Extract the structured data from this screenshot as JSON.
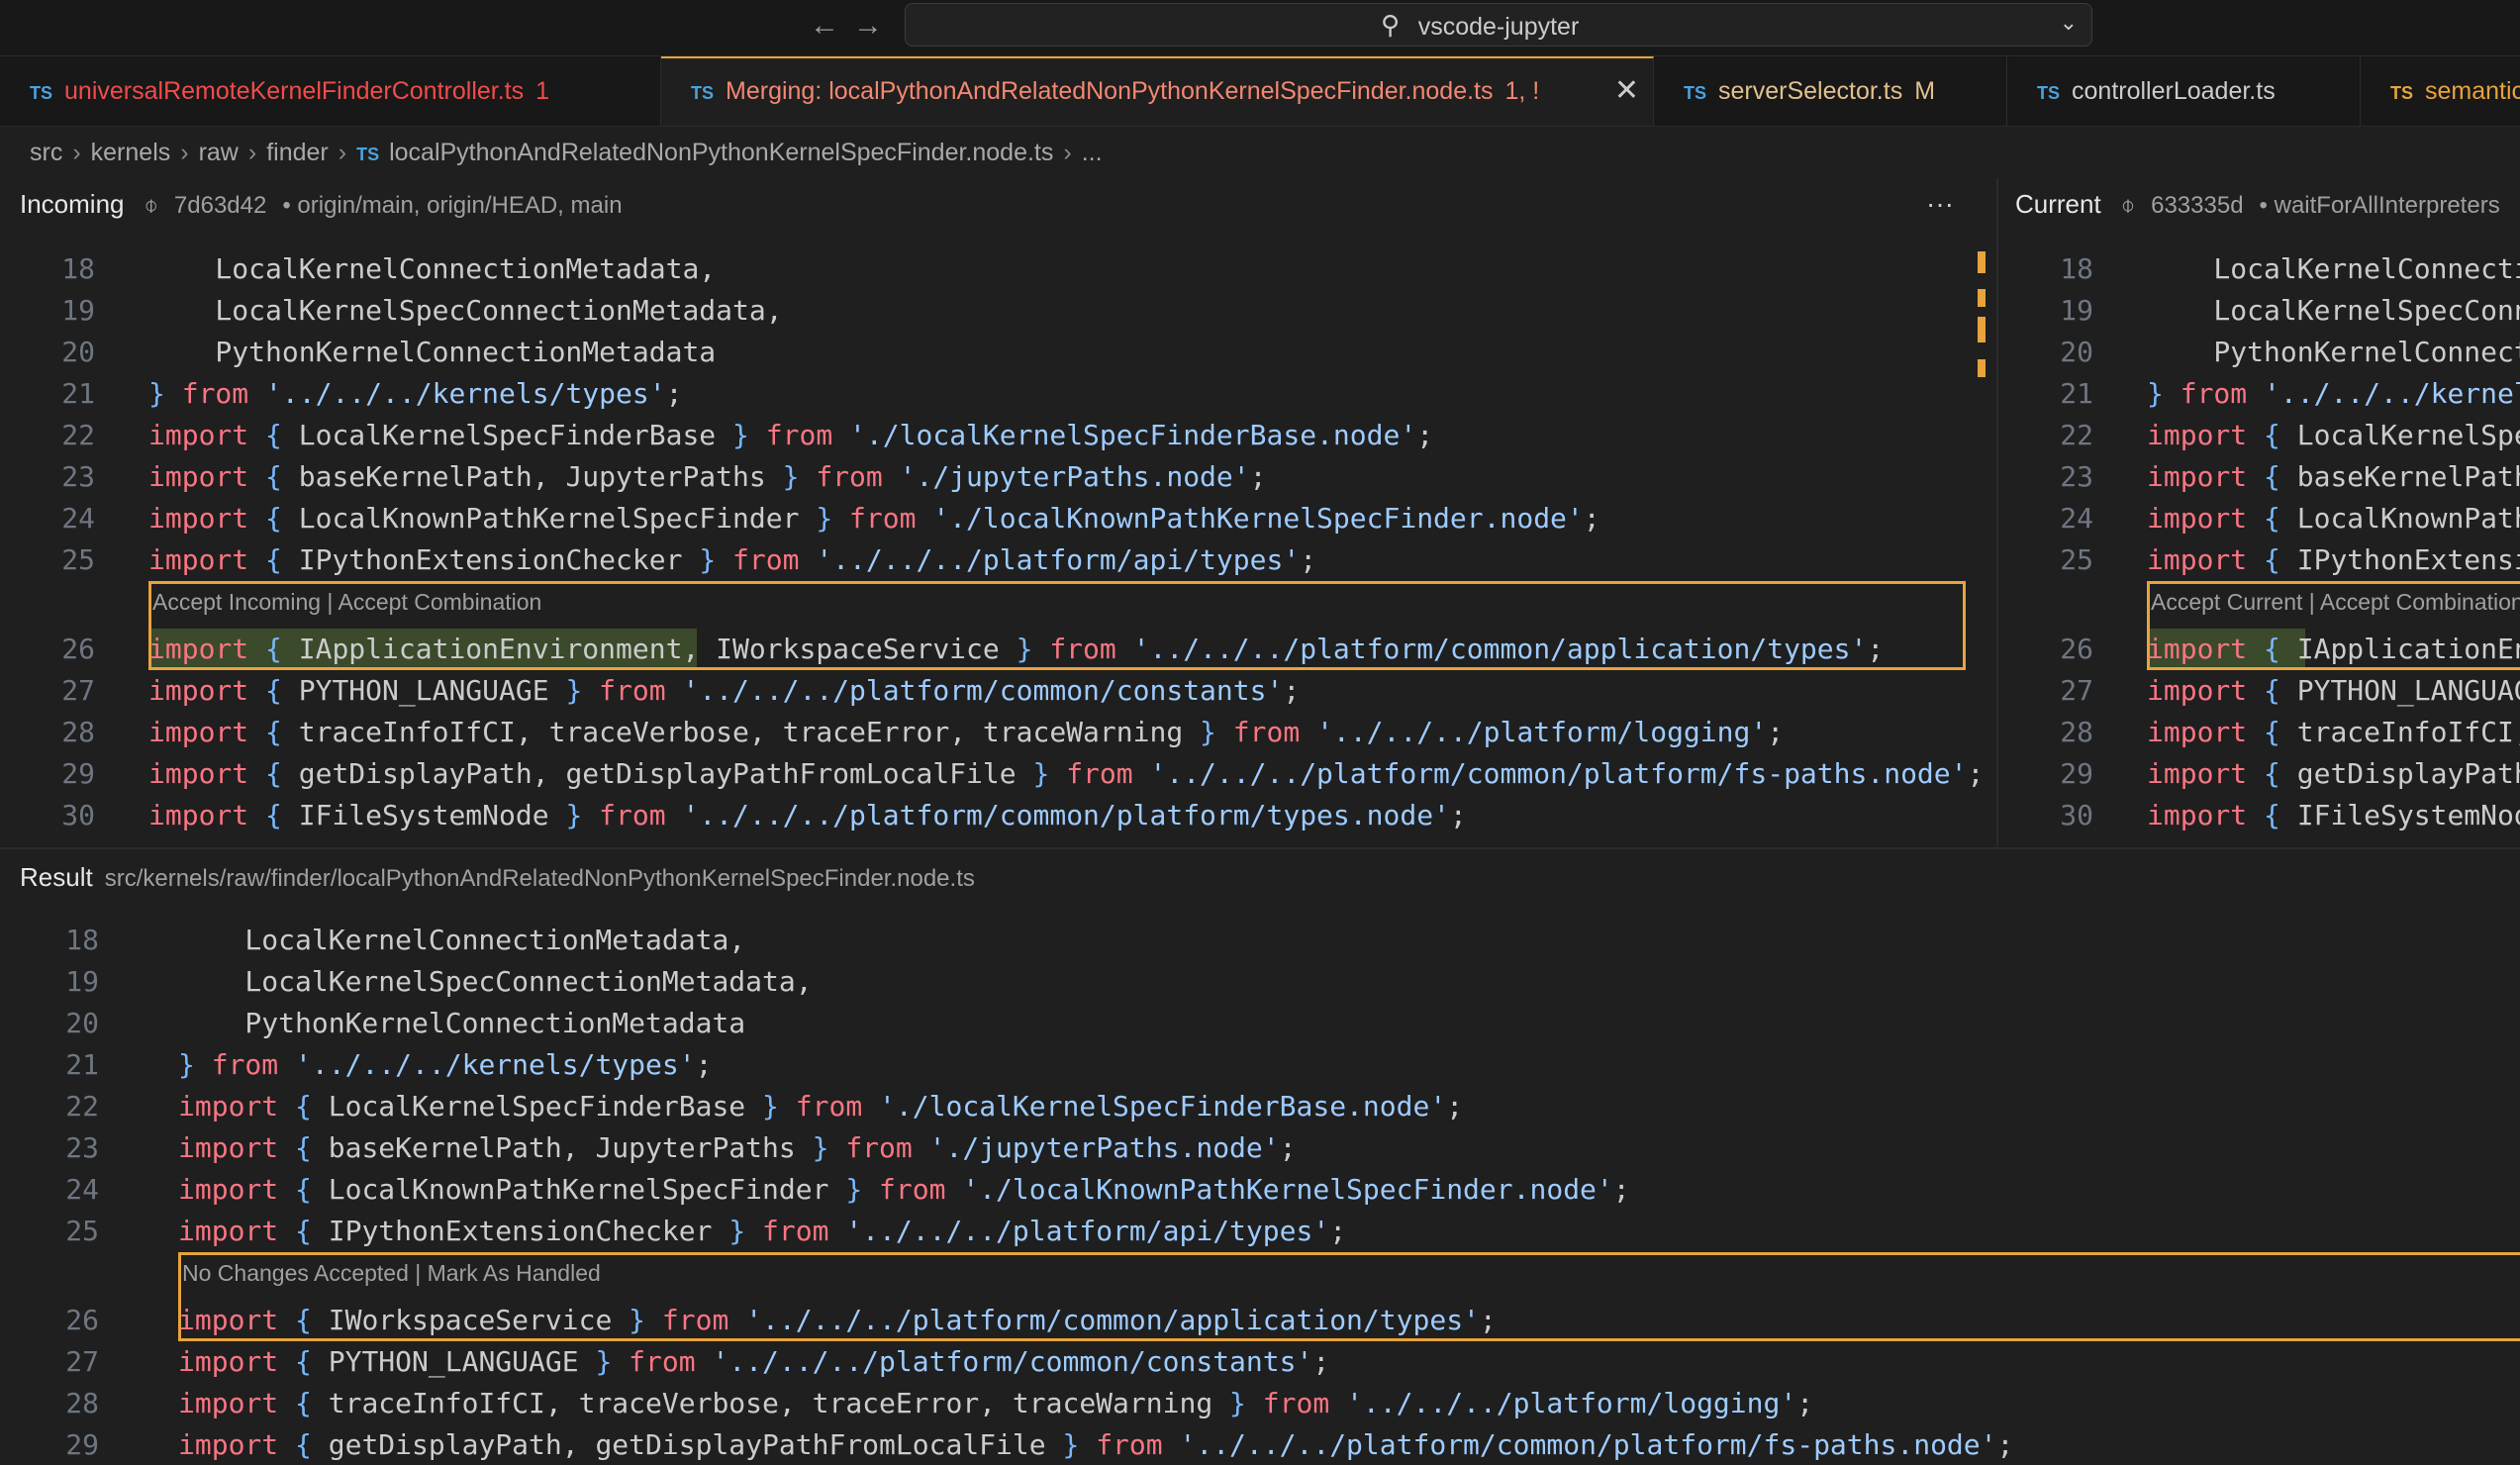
{
  "window": {
    "title": "vscode-jupyter",
    "back_icon": "arrow-left-icon",
    "forward_icon": "arrow-right-icon"
  },
  "tabs": [
    {
      "label": "universalRemoteKernelFinderController.ts",
      "badge": "1",
      "state": "error"
    },
    {
      "label": "Merging: localPythonAndRelatedNonPythonKernelSpecFinder.node.ts",
      "badge": "1, !",
      "state": "active-error"
    },
    {
      "label": "serverSelector.ts",
      "badge": "M",
      "state": "modified"
    },
    {
      "label": "controllerLoader.ts",
      "badge": "",
      "state": "plain"
    },
    {
      "label": "semantic",
      "badge": "",
      "state": "error"
    }
  ],
  "tab_prefix": "TS",
  "breadcrumb": [
    "src",
    "kernels",
    "raw",
    "finder",
    "localPythonAndRelatedNonPythonKernelSpecFinder.node.ts",
    "..."
  ],
  "incoming": {
    "title": "Incoming",
    "hash": "7d63d42",
    "refs": "• origin/main, origin/HEAD, main",
    "more": "···",
    "codelens": "Accept Incoming | Accept Combination"
  },
  "current": {
    "title": "Current",
    "hash": "633335d",
    "refs": "• waitForAllInterpreters",
    "codelens": "Accept Current | Accept Combination"
  },
  "result": {
    "title": "Result",
    "path": "src/kernels/raw/finder/localPythonAndRelatedNonPythonKernelSpecFinder.node.ts",
    "codelens": "No Changes Accepted | Mark As Handled"
  },
  "top_lines": [
    {
      "n": "18",
      "code": "    LocalKernelConnectionMetadata,"
    },
    {
      "n": "19",
      "code": "    LocalKernelSpecConnectionMetadata,"
    },
    {
      "n": "20",
      "code": "    PythonKernelConnectionMetadata"
    },
    {
      "n": "21",
      "code": "} from '../../../kernels/types';"
    },
    {
      "n": "22",
      "code": "import { LocalKernelSpecFinderBase } from './localKernelSpecFinderBase.node';"
    },
    {
      "n": "23",
      "code": "import { baseKernelPath, JupyterPaths } from './jupyterPaths.node';"
    },
    {
      "n": "24",
      "code": "import { LocalKnownPathKernelSpecFinder } from './localKnownPathKernelSpecFinder.node';"
    },
    {
      "n": "25",
      "code": "import { IPythonExtensionChecker } from '../../../platform/api/types';"
    },
    {
      "n": "26",
      "code": "import { IApplicationEnvironment, IWorkspaceService } from '../../../platform/common/application/types';"
    },
    {
      "n": "27",
      "code": "import { PYTHON_LANGUAGE } from '../../../platform/common/constants';"
    },
    {
      "n": "28",
      "code": "import { traceInfoIfCI, traceVerbose, traceError, traceWarning } from '../../../platform/logging';"
    },
    {
      "n": "29",
      "code": "import { getDisplayPath, getDisplayPathFromLocalFile } from '../../../platform/common/platform/fs-paths.node';"
    },
    {
      "n": "30",
      "code": "import { IFileSystemNode } from '../../../platform/common/platform/types.node';"
    }
  ],
  "result_lines": [
    {
      "n": "18",
      "code": "    LocalKernelConnectionMetadata,"
    },
    {
      "n": "19",
      "code": "    LocalKernelSpecConnectionMetadata,"
    },
    {
      "n": "20",
      "code": "    PythonKernelConnectionMetadata"
    },
    {
      "n": "21",
      "code": "} from '../../../kernels/types';"
    },
    {
      "n": "22",
      "code": "import { LocalKernelSpecFinderBase } from './localKernelSpecFinderBase.node';"
    },
    {
      "n": "23",
      "code": "import { baseKernelPath, JupyterPaths } from './jupyterPaths.node';"
    },
    {
      "n": "24",
      "code": "import { LocalKnownPathKernelSpecFinder } from './localKnownPathKernelSpecFinder.node';"
    },
    {
      "n": "25",
      "code": "import { IPythonExtensionChecker } from '../../../platform/api/types';"
    },
    {
      "n": "26",
      "code": "import { IWorkspaceService } from '../../../platform/common/application/types';"
    },
    {
      "n": "27",
      "code": "import { PYTHON_LANGUAGE } from '../../../platform/common/constants';"
    },
    {
      "n": "28",
      "code": "import { traceInfoIfCI, traceVerbose, traceError, traceWarning } from '../../../platform/logging';"
    },
    {
      "n": "29",
      "code": "import { getDisplayPath, getDisplayPathFromLocalFile } from '../../../platform/common/platform/fs-paths.node';"
    }
  ],
  "colors": {
    "accent": "#e8a33d",
    "keyword": "#f97583",
    "string": "#9ecbff",
    "brace": "#79b8ff",
    "error_tab": "#f14c4c",
    "modified_tab": "#e2c08d"
  }
}
